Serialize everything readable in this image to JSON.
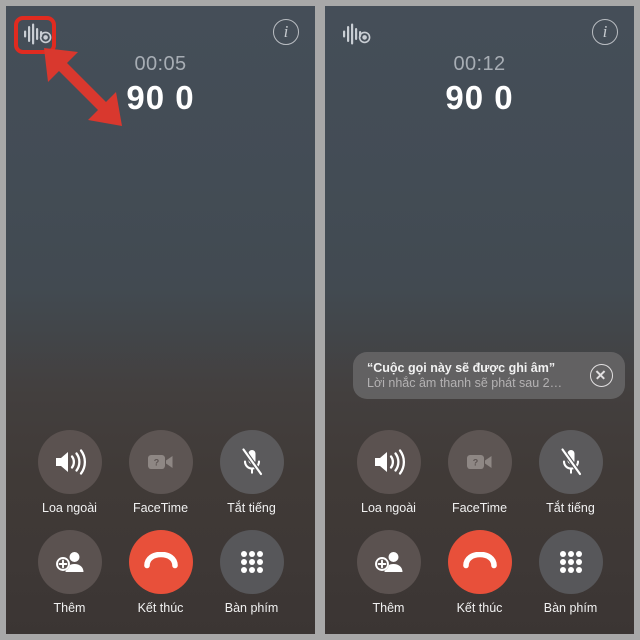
{
  "screenshot": {
    "title": "iPhone call screen with call recording",
    "background_color": "#a8a8a8",
    "divider_color": "#b0b0b0"
  },
  "panels": [
    {
      "id": "left",
      "header": {
        "recording_icon": "audio-waveform-record-icon",
        "info_button": "i"
      },
      "call": {
        "timer": "00:05",
        "number": "90 0"
      },
      "banner": null,
      "controls": [
        {
          "icon": "speaker-wave-icon",
          "label": "Loa ngoài",
          "style": "warm"
        },
        {
          "icon": "facetime-video-disabled-icon",
          "label": "FaceTime",
          "style": "dim"
        },
        {
          "icon": "microphone-slash-icon",
          "label": "Tắt tiếng",
          "style": "cool"
        },
        {
          "icon": "add-person-icon",
          "label": "Thêm",
          "style": "warm"
        },
        {
          "icon": "end-call-handset-icon",
          "label": "Kết thúc",
          "style": "end"
        },
        {
          "icon": "keypad-dots-icon",
          "label": "Bàn phím",
          "style": "neutral"
        }
      ],
      "annotations": {
        "highlight_box_color": "#e02b20",
        "arrow_color": "#d9382e",
        "arrow_target": "recording-icon"
      }
    },
    {
      "id": "right",
      "header": {
        "recording_icon": "audio-waveform-record-icon",
        "info_button": "i"
      },
      "call": {
        "timer": "00:12",
        "number": "90 0"
      },
      "banner": {
        "title": "“Cuộc gọi này sẽ được ghi âm”",
        "subtitle": "Lời nhắc âm thanh sẽ phát sau 2…",
        "close_icon": "close-circle-icon"
      },
      "controls": [
        {
          "icon": "speaker-wave-icon",
          "label": "Loa ngoài",
          "style": "warm"
        },
        {
          "icon": "facetime-video-disabled-icon",
          "label": "FaceTime",
          "style": "dim"
        },
        {
          "icon": "microphone-slash-icon",
          "label": "Tắt tiếng",
          "style": "cool"
        },
        {
          "icon": "add-person-icon",
          "label": "Thêm",
          "style": "warm"
        },
        {
          "icon": "end-call-handset-icon",
          "label": "Kết thúc",
          "style": "end"
        },
        {
          "icon": "keypad-dots-icon",
          "label": "Bàn phím",
          "style": "neutral"
        }
      ],
      "annotations": null
    }
  ]
}
